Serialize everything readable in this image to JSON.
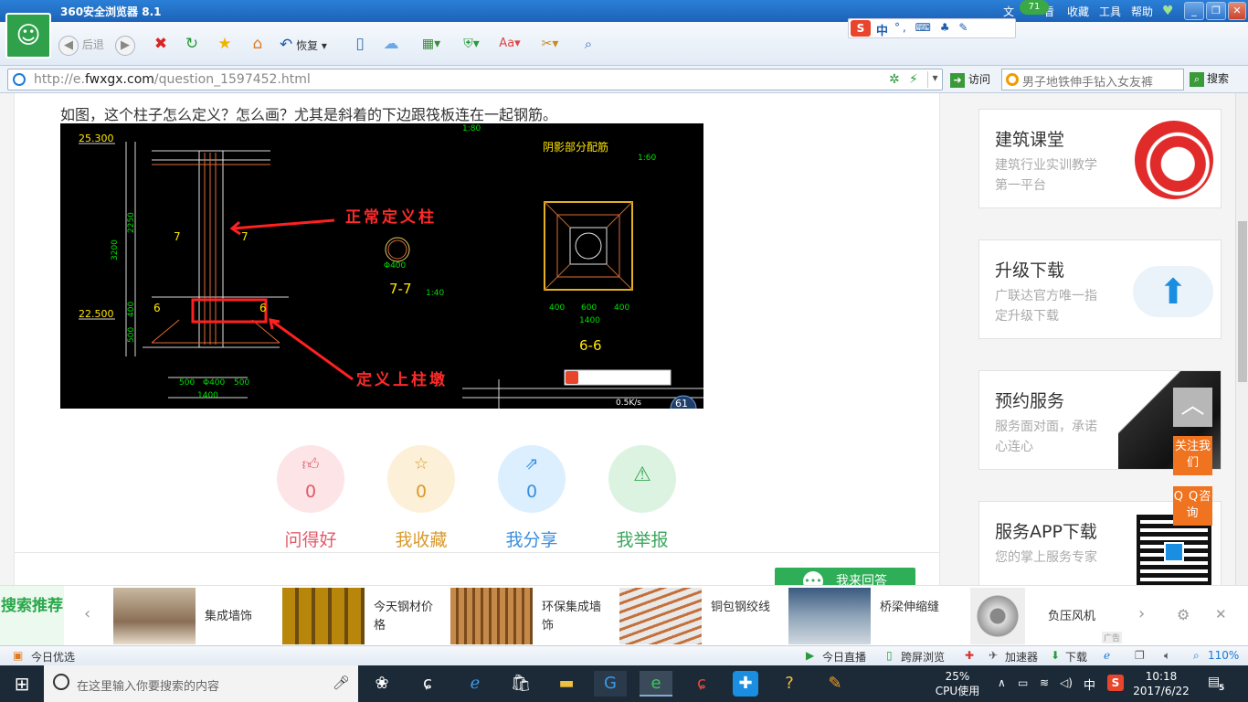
{
  "browser": {
    "title": "360安全浏览器 8.1",
    "menu": [
      "文",
      "看",
      "收藏",
      "工具",
      "帮助"
    ],
    "badge": "71",
    "back_label": "后退",
    "restore_label": "恢复",
    "url_prefix": "http://e.",
    "url_domain": "fwxgx.com",
    "url_path": "/question_1597452.html",
    "visit_label": "访问",
    "search_placeholder": "男子地铁伸手钻入女友裤",
    "search_button": "搜索",
    "ime_logo": "S",
    "ime_mode": "中",
    "ime_rest": "°, ⌨ ♣ ✎"
  },
  "question": {
    "text": "如图，这个柱子怎么定义？怎么画？尤其是斜着的下边跟筏板连在一起钢筋。"
  },
  "cad": {
    "annotations": [
      "正常定义柱",
      "定义上柱墩"
    ],
    "labels": [
      "25.300",
      "22.500",
      "阴影部分配筋",
      "7-7",
      "6-6",
      "1:40",
      "1:60",
      "1:80",
      "Φ400",
      "500",
      "Φ400",
      "500",
      "1400",
      "400",
      "600",
      "400",
      "1400",
      "3200",
      "2250",
      "400",
      "500",
      "7",
      "7",
      "6",
      "6",
      "0.5K/s",
      "61"
    ]
  },
  "actions": [
    {
      "label": "问得好",
      "count": "0",
      "icon": "thumbs-up-icon",
      "color": "#e15a6a",
      "bg": "#fde4e7"
    },
    {
      "label": "我收藏",
      "count": "0",
      "icon": "star-icon",
      "color": "#d99a2b",
      "bg": "#fdf0d8"
    },
    {
      "label": "我分享",
      "count": "0",
      "icon": "share-icon",
      "color": "#3a8ee0",
      "bg": "#dcefff"
    },
    {
      "label": "我举报",
      "count": "",
      "icon": "warning-icon",
      "color": "#3aa85a",
      "bg": "#dcf3e2"
    }
  ],
  "answer_button": "我来回答",
  "sidebar": [
    {
      "title": "建筑课堂",
      "desc": "建筑行业实训教学第一平台"
    },
    {
      "title": "升级下载",
      "desc": "广联达官方唯一指定升级下载"
    },
    {
      "title": "预约服务",
      "desc": "服务面对面，承诺心连心"
    },
    {
      "title": "服务APP下载",
      "desc": "您的掌上服务专家"
    }
  ],
  "float": {
    "follow": "关注我们",
    "qq": "Q Q咨询"
  },
  "recommend": {
    "label": "搜索推荐",
    "items": [
      "集成墙饰",
      "今天钢材价格",
      "环保集成墙饰",
      "铜包钢绞线",
      "桥梁伸缩缝",
      "负压风机"
    ],
    "ad": "广告"
  },
  "statusbar": {
    "left": "今日优选",
    "live": "今日直播",
    "cross": "跨屏浏览",
    "accel": "加速器",
    "download": "下载",
    "zoom": "110%"
  },
  "taskbar": {
    "search_placeholder": "在这里输入你要搜索的内容",
    "cpu_percent": "25%",
    "cpu_label": "CPU使用",
    "ime": "中",
    "time": "10:18",
    "date": "2017/6/22",
    "notify": "5"
  }
}
